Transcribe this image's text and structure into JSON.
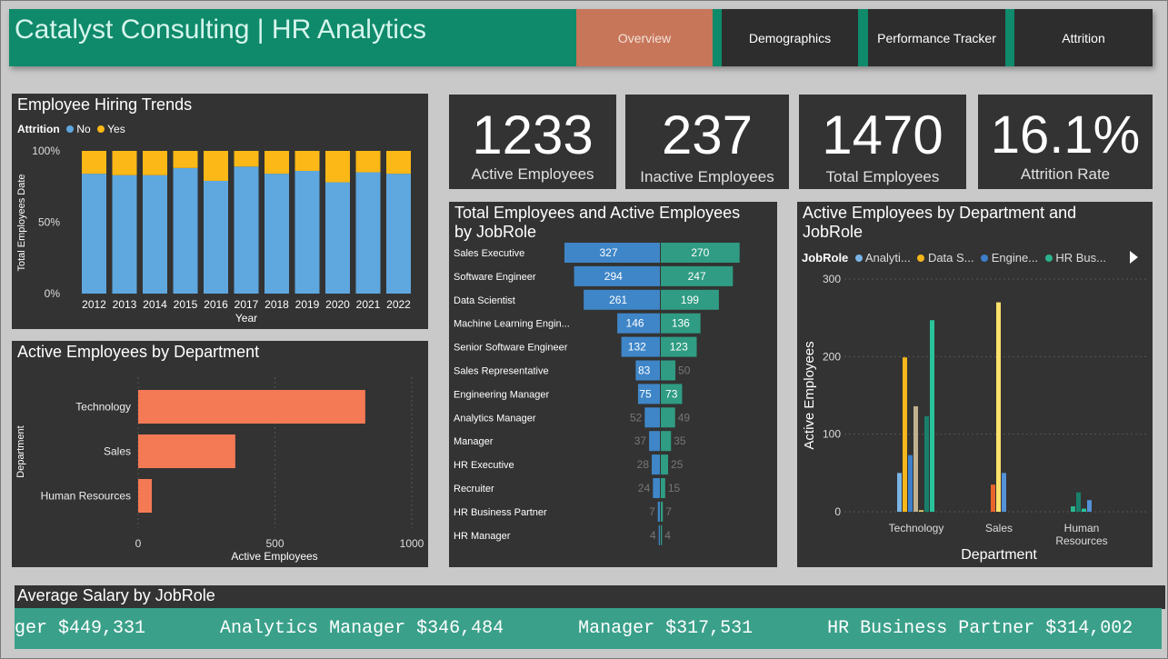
{
  "header": {
    "title": "Catalyst Consulting | HR Analytics",
    "tabs": [
      {
        "label": "Overview",
        "active": true
      },
      {
        "label": "Demographics",
        "active": false
      },
      {
        "label": "Performance Tracker",
        "active": false
      },
      {
        "label": "Attrition",
        "active": false
      }
    ]
  },
  "colors": {
    "accent": "#0f8a6b",
    "active_tab": "#c8765a",
    "panel": "#333333",
    "no": "#5ea7df",
    "yes": "#fbb816",
    "dept_bar": "#f47a55",
    "total": "#3f86c8",
    "active": "#2f9c83"
  },
  "kpis": [
    {
      "value": "1233",
      "label": "Active Employees"
    },
    {
      "value": "237",
      "label": "Inactive Employees"
    },
    {
      "value": "1470",
      "label": "Total Employees"
    },
    {
      "value": "16.1%",
      "label": "Attrition Rate"
    }
  ],
  "hiring": {
    "title": "Employee Hiring Trends",
    "legend_title": "Attrition",
    "legend": [
      "No",
      "Yes"
    ]
  },
  "dept_panel": {
    "title": "Active Employees by Department"
  },
  "jobrole_panel": {
    "title_line1": "Total Employees and Active Employees",
    "title_line2": "by JobRole"
  },
  "deptjob_panel": {
    "title_line1": "Active Employees by Department and",
    "title_line2": "JobRole",
    "legend_title": "JobRole",
    "legend": [
      "Analyti...",
      "Data S...",
      "Engine...",
      "HR Bus..."
    ],
    "next_icon": "triangle-right-icon"
  },
  "salary": {
    "title": "Average Salary by JobRole",
    "ticker": [
      "ger $449,331",
      "Analytics Manager $346,484",
      "Manager $317,531",
      "HR Business Partner $314,002"
    ]
  },
  "chart_data": [
    {
      "type": "bar",
      "stacked": "100%",
      "title": "Employee Hiring Trends",
      "xlabel": "Year",
      "ylabel": "Total Employees Date",
      "categories": [
        "2012",
        "2013",
        "2014",
        "2015",
        "2016",
        "2017",
        "2018",
        "2019",
        "2020",
        "2021",
        "2022"
      ],
      "series": [
        {
          "name": "No",
          "values": [
            84,
            83,
            83,
            88,
            79,
            89,
            84,
            86,
            78,
            85,
            84
          ]
        },
        {
          "name": "Yes",
          "values": [
            16,
            17,
            17,
            12,
            21,
            11,
            16,
            14,
            22,
            15,
            16
          ]
        }
      ],
      "yticks": [
        "0%",
        "50%",
        "100%"
      ],
      "ylim": [
        0,
        100
      ]
    },
    {
      "type": "bar",
      "orientation": "horizontal",
      "title": "Active Employees by Department",
      "xlabel": "Active Employees",
      "ylabel": "Department",
      "categories": [
        "Technology",
        "Sales",
        "Human Resources"
      ],
      "values": [
        830,
        355,
        50
      ],
      "xticks": [
        "0",
        "500",
        "1000"
      ],
      "xlim": [
        0,
        1000
      ]
    },
    {
      "type": "bar",
      "orientation": "horizontal",
      "title": "Total Employees and Active Employees by JobRole",
      "categories": [
        "Sales Executive",
        "Software Engineer",
        "Data Scientist",
        "Machine Learning Engin...",
        "Senior Software Engineer",
        "Sales Representative",
        "Engineering Manager",
        "Analytics Manager",
        "Manager",
        "HR Executive",
        "Recruiter",
        "HR Business Partner",
        "HR Manager"
      ],
      "series": [
        {
          "name": "Total Employees",
          "values": [
            327,
            294,
            261,
            146,
            132,
            83,
            75,
            52,
            37,
            28,
            24,
            7,
            4
          ]
        },
        {
          "name": "Active Employees",
          "values": [
            270,
            247,
            199,
            136,
            123,
            50,
            73,
            49,
            35,
            25,
            15,
            7,
            4
          ]
        }
      ]
    },
    {
      "type": "bar",
      "title": "Active Employees by Department and JobRole",
      "xlabel": "Department",
      "ylabel": "Active Employees",
      "categories": [
        "Technology",
        "Sales",
        "Human Resources"
      ],
      "series": [
        {
          "name": "Analyti...",
          "color": "#79b4e5",
          "values": [
            50,
            0,
            0
          ]
        },
        {
          "name": "Data S...",
          "color": "#f5b71b",
          "values": [
            199,
            0,
            0
          ]
        },
        {
          "name": "Engine...",
          "color": "#3d7fc9",
          "values": [
            73,
            0,
            0
          ]
        },
        {
          "color": "#c1b18f",
          "values": [
            136,
            0,
            0
          ]
        },
        {
          "color": "#e9d36a",
          "values": [
            2,
            0,
            0
          ]
        },
        {
          "name": "HR Bus...",
          "color": "#2bb38e",
          "values": [
            0,
            0,
            7
          ]
        },
        {
          "color": "#19806b",
          "values": [
            123,
            0,
            25
          ]
        },
        {
          "color": "#29c39a",
          "values": [
            247,
            0,
            4
          ]
        },
        {
          "color": "#e8642b",
          "values": [
            0,
            35,
            0
          ]
        },
        {
          "color": "#ffe06b",
          "values": [
            0,
            270,
            0
          ]
        },
        {
          "color": "#5591d8",
          "values": [
            0,
            50,
            15
          ]
        }
      ],
      "yticks": [
        "0",
        "100",
        "200",
        "300"
      ],
      "ylim": [
        0,
        300
      ]
    }
  ]
}
